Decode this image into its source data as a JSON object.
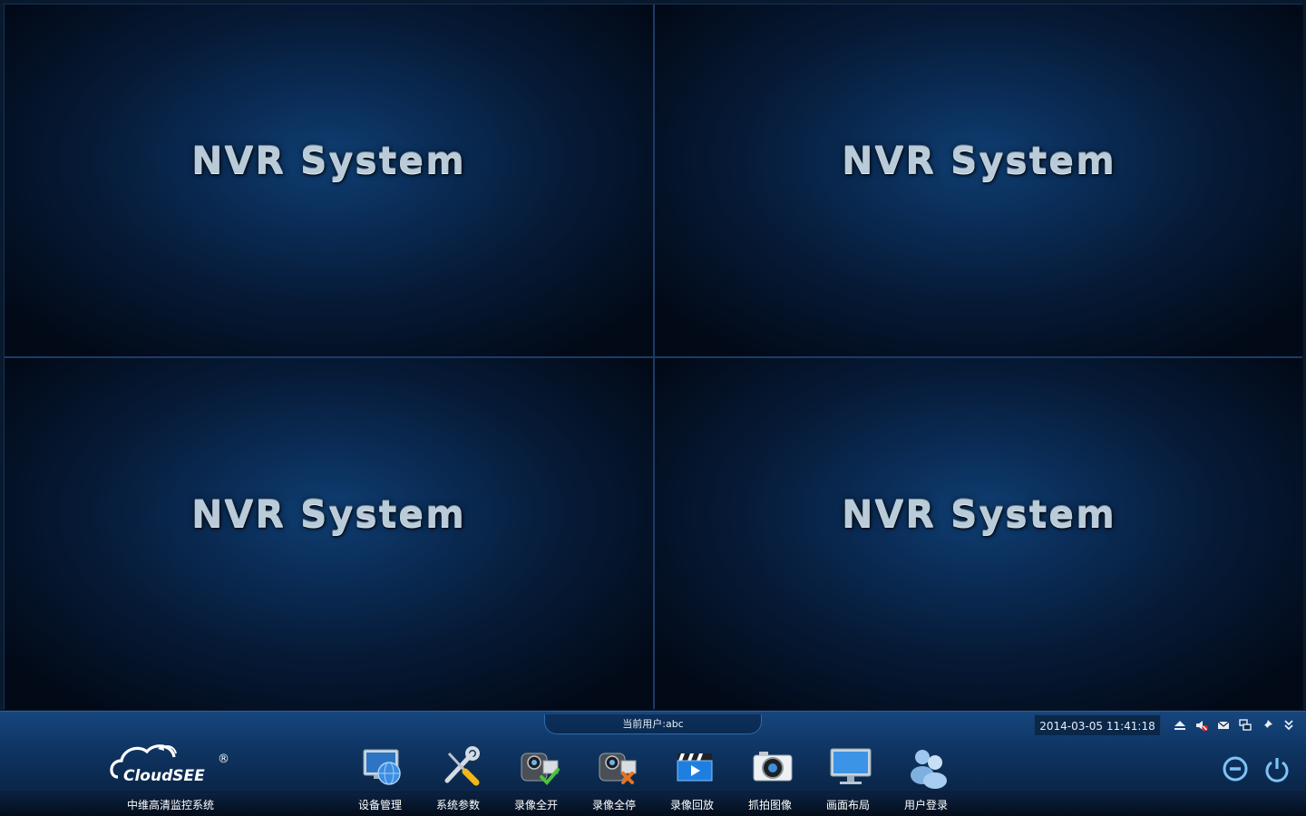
{
  "panes": [
    {
      "title": "NVR System"
    },
    {
      "title": "NVR System"
    },
    {
      "title": "NVR System"
    },
    {
      "title": "NVR System"
    }
  ],
  "status": {
    "current_user": "当前用户:abc",
    "datetime": "2014-03-05 11:41:18"
  },
  "tray_icons": [
    "eject-icon",
    "mute-icon",
    "mail-icon",
    "network-icon",
    "pin-icon",
    "chevron-down-icon"
  ],
  "brand": {
    "logo_text": "CloudSEE",
    "registered_mark": "®",
    "caption": "中维高清监控系统"
  },
  "menu": [
    {
      "label": "设备管理",
      "icon": "device-management-icon"
    },
    {
      "label": "系统参数",
      "icon": "system-settings-icon"
    },
    {
      "label": "录像全开",
      "icon": "record-all-on-icon"
    },
    {
      "label": "录像全停",
      "icon": "record-all-stop-icon"
    },
    {
      "label": "录像回放",
      "icon": "playback-icon"
    },
    {
      "label": "抓拍图像",
      "icon": "snapshot-icon"
    },
    {
      "label": "画面布局",
      "icon": "layout-icon"
    },
    {
      "label": "用户登录",
      "icon": "user-login-icon"
    }
  ],
  "window_controls": [
    "minimize-icon",
    "power-icon"
  ],
  "colors": {
    "accent": "#1a5c9e",
    "background": "#0a1a2e",
    "text": "#ffffff"
  }
}
